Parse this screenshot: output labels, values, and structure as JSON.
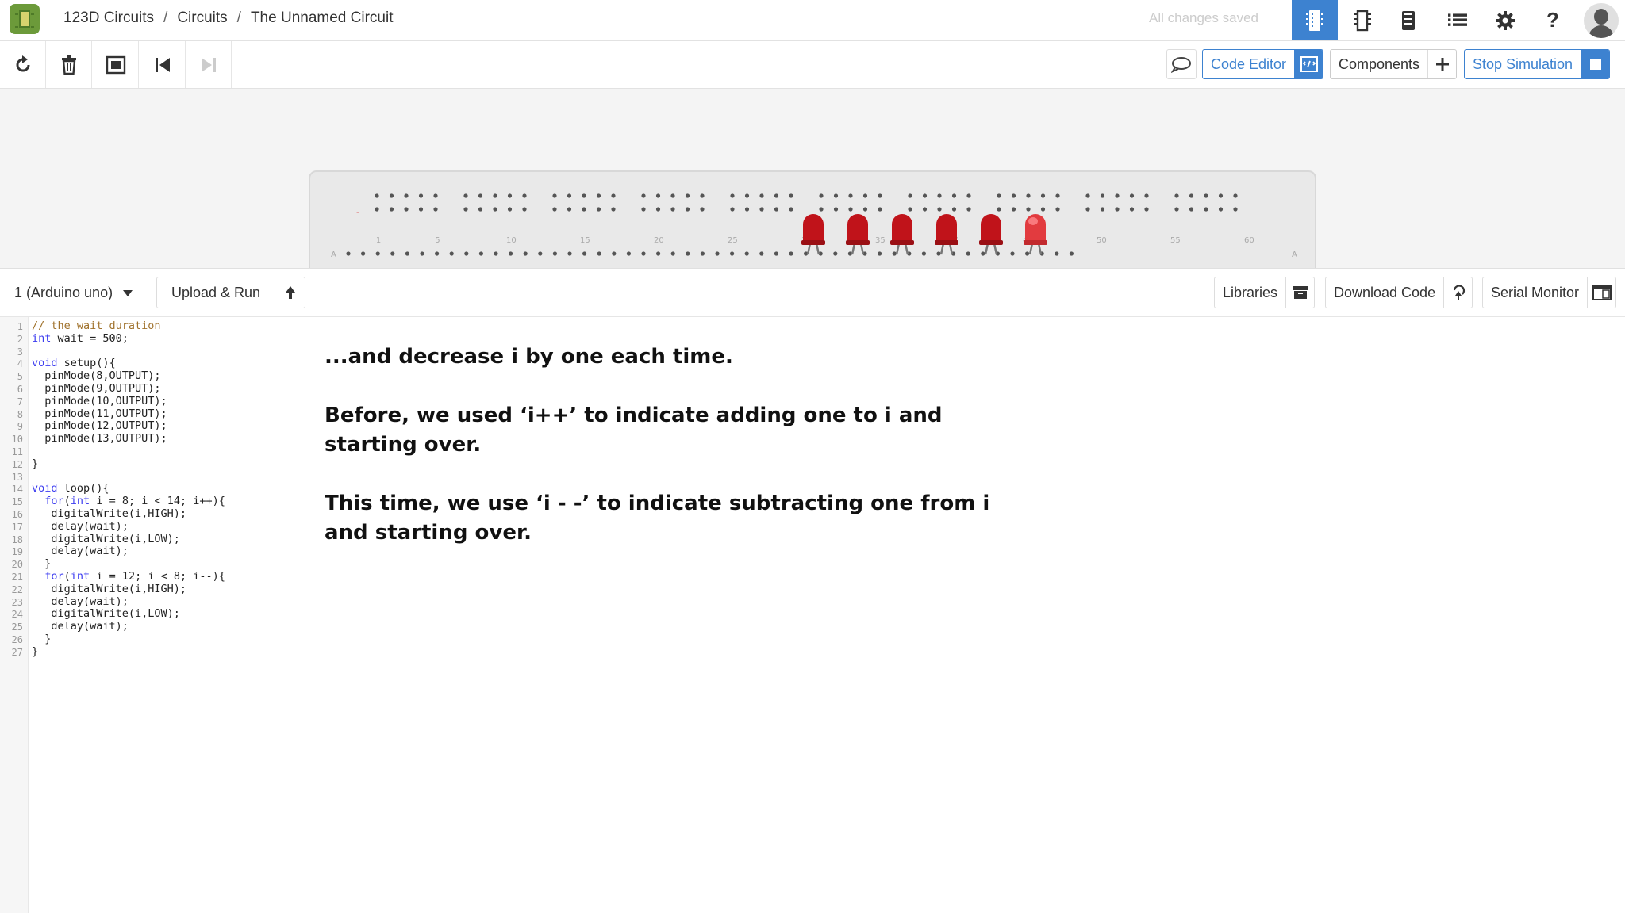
{
  "header": {
    "breadcrumb": [
      "123D Circuits",
      "Circuits",
      "The Unnamed Circuit"
    ],
    "save_status": "All changes saved",
    "help_label": "?"
  },
  "toolbar": {
    "code_editor_label": "Code Editor",
    "components_label": "Components",
    "stop_simulation_label": "Stop Simulation"
  },
  "code_panel": {
    "board_select": "1 (Arduino uno)",
    "upload_label": "Upload & Run",
    "libraries_label": "Libraries",
    "download_label": "Download Code",
    "serial_monitor_label": "Serial Monitor"
  },
  "breadboard": {
    "column_labels": [
      "1",
      "5",
      "10",
      "15",
      "20",
      "25",
      "30",
      "35",
      "40",
      "45",
      "50",
      "55",
      "60"
    ],
    "led_count": 6,
    "lit_led_index": 5,
    "led_color": "#c0131a",
    "lit_led_color": "#e23b3f"
  },
  "code_lines": [
    "// the wait duration",
    "int wait = 500;",
    "",
    "void setup(){",
    "  pinMode(8,OUTPUT);",
    "  pinMode(9,OUTPUT);",
    "  pinMode(10,OUTPUT);",
    "  pinMode(11,OUTPUT);",
    "  pinMode(12,OUTPUT);",
    "  pinMode(13,OUTPUT);",
    "",
    "}",
    "",
    "void loop(){",
    "  for(int i = 8; i < 14; i++){",
    "   digitalWrite(i,HIGH);",
    "   delay(wait);",
    "   digitalWrite(i,LOW);",
    "   delay(wait);",
    "  }",
    "  for(int i = 12; i < 8; i--){",
    "   digitalWrite(i,HIGH);",
    "   delay(wait);",
    "   digitalWrite(i,LOW);",
    "   delay(wait);",
    "  }",
    "}"
  ],
  "caption": {
    "line1": "...and decrease i by one each time.",
    "line2": "Before, we used ‘i++’ to indicate adding one to i and starting over.",
    "line3": "This time, we use ‘i - -’ to indicate subtracting one from i and starting over."
  },
  "colors": {
    "accent": "#3d82d0",
    "logo_green": "#6c9a3a"
  }
}
